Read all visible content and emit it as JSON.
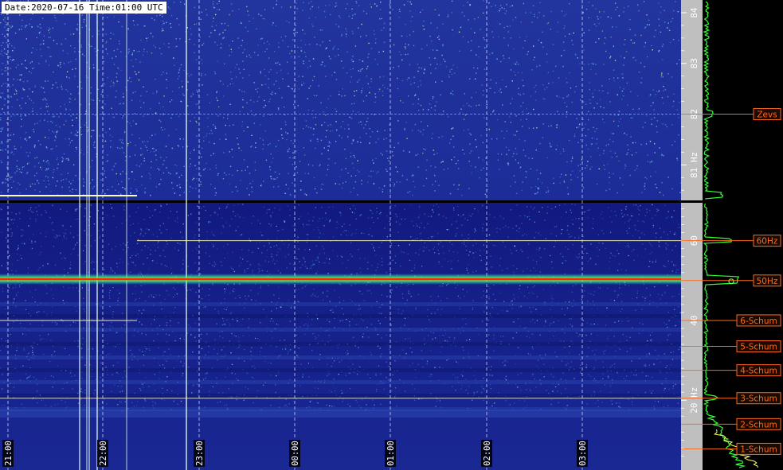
{
  "header": {
    "timestamp": "Date:2020-07-16 Time:01:00 UTC"
  },
  "time_axis": [
    {
      "label": "21:00"
    },
    {
      "label": "22:00"
    },
    {
      "label": "23:00"
    },
    {
      "label": "00:00"
    },
    {
      "label": "01:00"
    },
    {
      "label": "02:00"
    },
    {
      "label": "03:00"
    }
  ],
  "freq_axis_upper": [
    {
      "label": "84",
      "hz": 84
    },
    {
      "label": "83",
      "hz": 83
    },
    {
      "label": "82",
      "hz": 82
    },
    {
      "label": "81 Hz",
      "hz": 81
    }
  ],
  "freq_axis_lower": [
    {
      "label": "60",
      "hz": 60
    },
    {
      "label": "40",
      "hz": 40
    },
    {
      "label": "20 Hz",
      "hz": 20
    }
  ],
  "markers": [
    {
      "label": "Zevs",
      "hz": 82,
      "panel": "upper"
    },
    {
      "label": "60Hz",
      "hz": 60,
      "panel": "lower"
    },
    {
      "label": "50Hz",
      "hz": 50,
      "panel": "lower"
    },
    {
      "label": "6-Schum",
      "hz": 40,
      "panel": "lower"
    },
    {
      "label": "5-Schum",
      "hz": 33.5,
      "panel": "lower"
    },
    {
      "label": "4-Schum",
      "hz": 27.5,
      "panel": "lower"
    },
    {
      "label": "3-Schum",
      "hz": 20.5,
      "panel": "lower"
    },
    {
      "label": "2-Schum",
      "hz": 14,
      "panel": "lower"
    },
    {
      "label": "1-Schum",
      "hz": 7.8,
      "panel": "lower"
    }
  ],
  "colors": {
    "background_upper": "#1a2a9c",
    "background_lower": "#141f86",
    "marker": "#ff6a1a",
    "tick_text": "#ffffff",
    "spectrum": "#33ff33",
    "spectrum_secondary": "#ffff66",
    "hum_line": "#ff2a00"
  }
}
